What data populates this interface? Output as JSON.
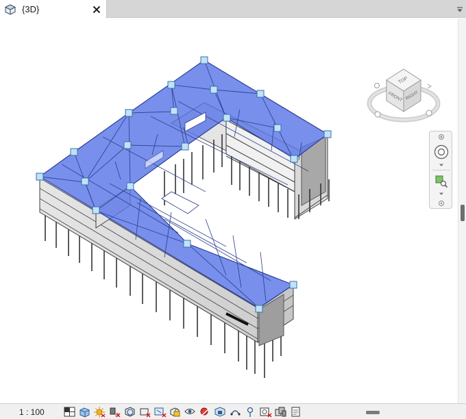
{
  "tab": {
    "title": "{3D}",
    "icon": "cube-3d-view-icon",
    "close_icon": "close-icon",
    "menu_icon": "chevron-down-icon"
  },
  "viewcube": {
    "faces": {
      "top": "TOP",
      "front": "FRONT",
      "right": "RIGHT"
    },
    "icon": "view-cube-icon"
  },
  "navigation_bar": {
    "buttons": [
      "steering-wheel-icon",
      "zoom-region-icon"
    ]
  },
  "status_bar": {
    "scale": "1 : 100",
    "icons": [
      "detail-level-icon",
      "visual-style-icon",
      "sun-path-icon",
      "shadows-icon",
      "render-dialog-icon",
      "crop-view-icon",
      "show-crop-region-icon",
      "unlock-3d-view-icon",
      "temporary-hide-icon",
      "reveal-hidden-icon",
      "worksharing-display-icon",
      "analytical-model-icon",
      "highlight-displacement-icon",
      "reveal-constraints-icon",
      "worksets-icon",
      "design-options-icon"
    ]
  },
  "colors": {
    "selection_blue": "#5a78e8",
    "grip_fill": "#bfe3f7",
    "grip_stroke": "#3a6ea8",
    "tab_strip": "#d6d6d6"
  }
}
